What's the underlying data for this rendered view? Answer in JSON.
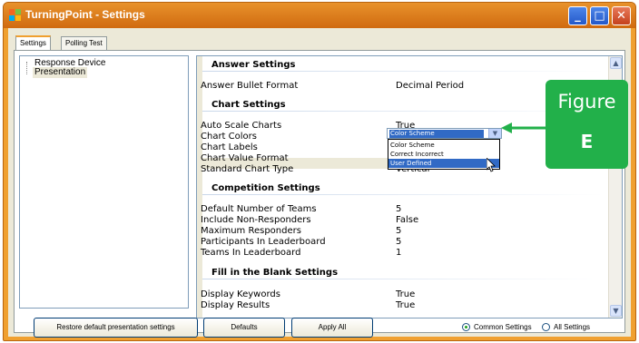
{
  "window": {
    "title": "TurningPoint - Settings"
  },
  "tabs": [
    {
      "label": "Settings",
      "active": true
    },
    {
      "label": "Polling Test",
      "active": false
    }
  ],
  "tree": {
    "items": [
      {
        "label": "Response Device"
      },
      {
        "label": "Presentation",
        "selected": true
      }
    ]
  },
  "sections": {
    "answer": {
      "title": "Answer Settings",
      "rows": [
        {
          "name": "Answer Bullet Format",
          "value": "Decimal Period"
        }
      ]
    },
    "chart": {
      "title": "Chart Settings",
      "rows": [
        {
          "name": "Auto Scale Charts",
          "value": "True"
        },
        {
          "name": "Chart Colors",
          "value": ""
        },
        {
          "name": "Chart Labels",
          "value": ""
        },
        {
          "name": "Chart Value Format",
          "value": ""
        },
        {
          "name": "Standard Chart Type",
          "value": "Vertical"
        }
      ]
    },
    "competition": {
      "title": "Competition Settings",
      "rows": [
        {
          "name": "Default Number of Teams",
          "value": "5"
        },
        {
          "name": "Include Non-Responders",
          "value": "False"
        },
        {
          "name": "Maximum Responders",
          "value": "5"
        },
        {
          "name": "Participants In Leaderboard",
          "value": "5"
        },
        {
          "name": "Teams In Leaderboard",
          "value": "1"
        }
      ]
    },
    "fill": {
      "title": "Fill in the Blank Settings",
      "rows": [
        {
          "name": "Display Keywords",
          "value": "True"
        },
        {
          "name": "Display Results",
          "value": "True"
        }
      ]
    }
  },
  "dropdown": {
    "selected": "Color Scheme",
    "options": [
      "Color Scheme",
      "Correct Incorrect",
      "User Defined"
    ],
    "highlighted": "User Defined"
  },
  "callout": {
    "line1": "Figure",
    "line2": "E",
    "color": "#22b04a"
  },
  "buttons": {
    "restore": "Restore default presentation settings",
    "defaults": "Defaults",
    "apply_all": "Apply All"
  },
  "radios": [
    {
      "label": "Common Settings",
      "checked": true
    },
    {
      "label": "All Settings",
      "checked": false
    }
  ],
  "colors": {
    "title_bar": "#e07a1c",
    "selection": "#316ac5",
    "accent_green": "#22b04a"
  }
}
